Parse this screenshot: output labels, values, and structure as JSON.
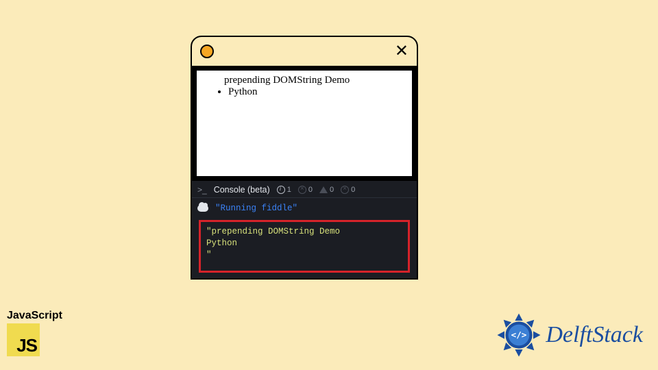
{
  "window": {
    "close_symbol": "✕"
  },
  "viewport": {
    "line1": "prepending DOMString Demo",
    "bullet1": "Python"
  },
  "console": {
    "title": "Console (beta)",
    "counts": {
      "info": "1",
      "err": "0",
      "warn": "0",
      "other": "0"
    },
    "running_msg": "\"Running fiddle\"",
    "output": {
      "quote_open": "\"",
      "line1": "prepending DOMString Demo",
      "line2": "    Python",
      "quote_close": "\""
    }
  },
  "js_badge": {
    "label": "JavaScript",
    "logo_text": "JS"
  },
  "brand": {
    "name": "DelftStack"
  }
}
